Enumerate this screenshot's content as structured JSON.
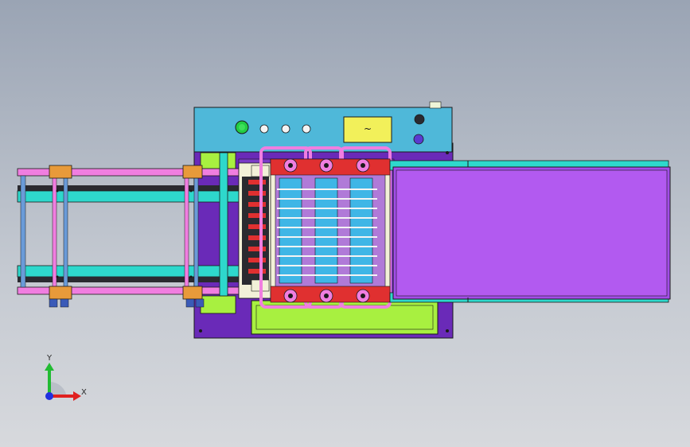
{
  "view": {
    "background_top": "#9aa4b4",
    "background_bottom": "#d7d9dd"
  },
  "palette": {
    "panel": "#4fb8d9",
    "base": "#6a2ab8",
    "rail_pink": "#f07ee0",
    "rail_cyan": "#2ed8cc",
    "dark_bar": "#2a2a30",
    "lime": "#a8f040",
    "conveyor": "#a24de8",
    "outline": "#1a1a1a",
    "roller": "#3fb6e6",
    "bracket_orange": "#e89a3a",
    "knob_green": "#22cc44",
    "knob_blue": "#5a3ad0",
    "display_yellow": "#f2f05a"
  },
  "control_panel": {
    "display_symbol": "~",
    "start_button_icon": "green-start-button",
    "stop_button_icon": "blue-stop-button"
  },
  "triad": {
    "y_label": "Y",
    "x_label": "X",
    "x_color": "#e02020",
    "y_color": "#22bb33",
    "z_color": "#2030e0"
  }
}
